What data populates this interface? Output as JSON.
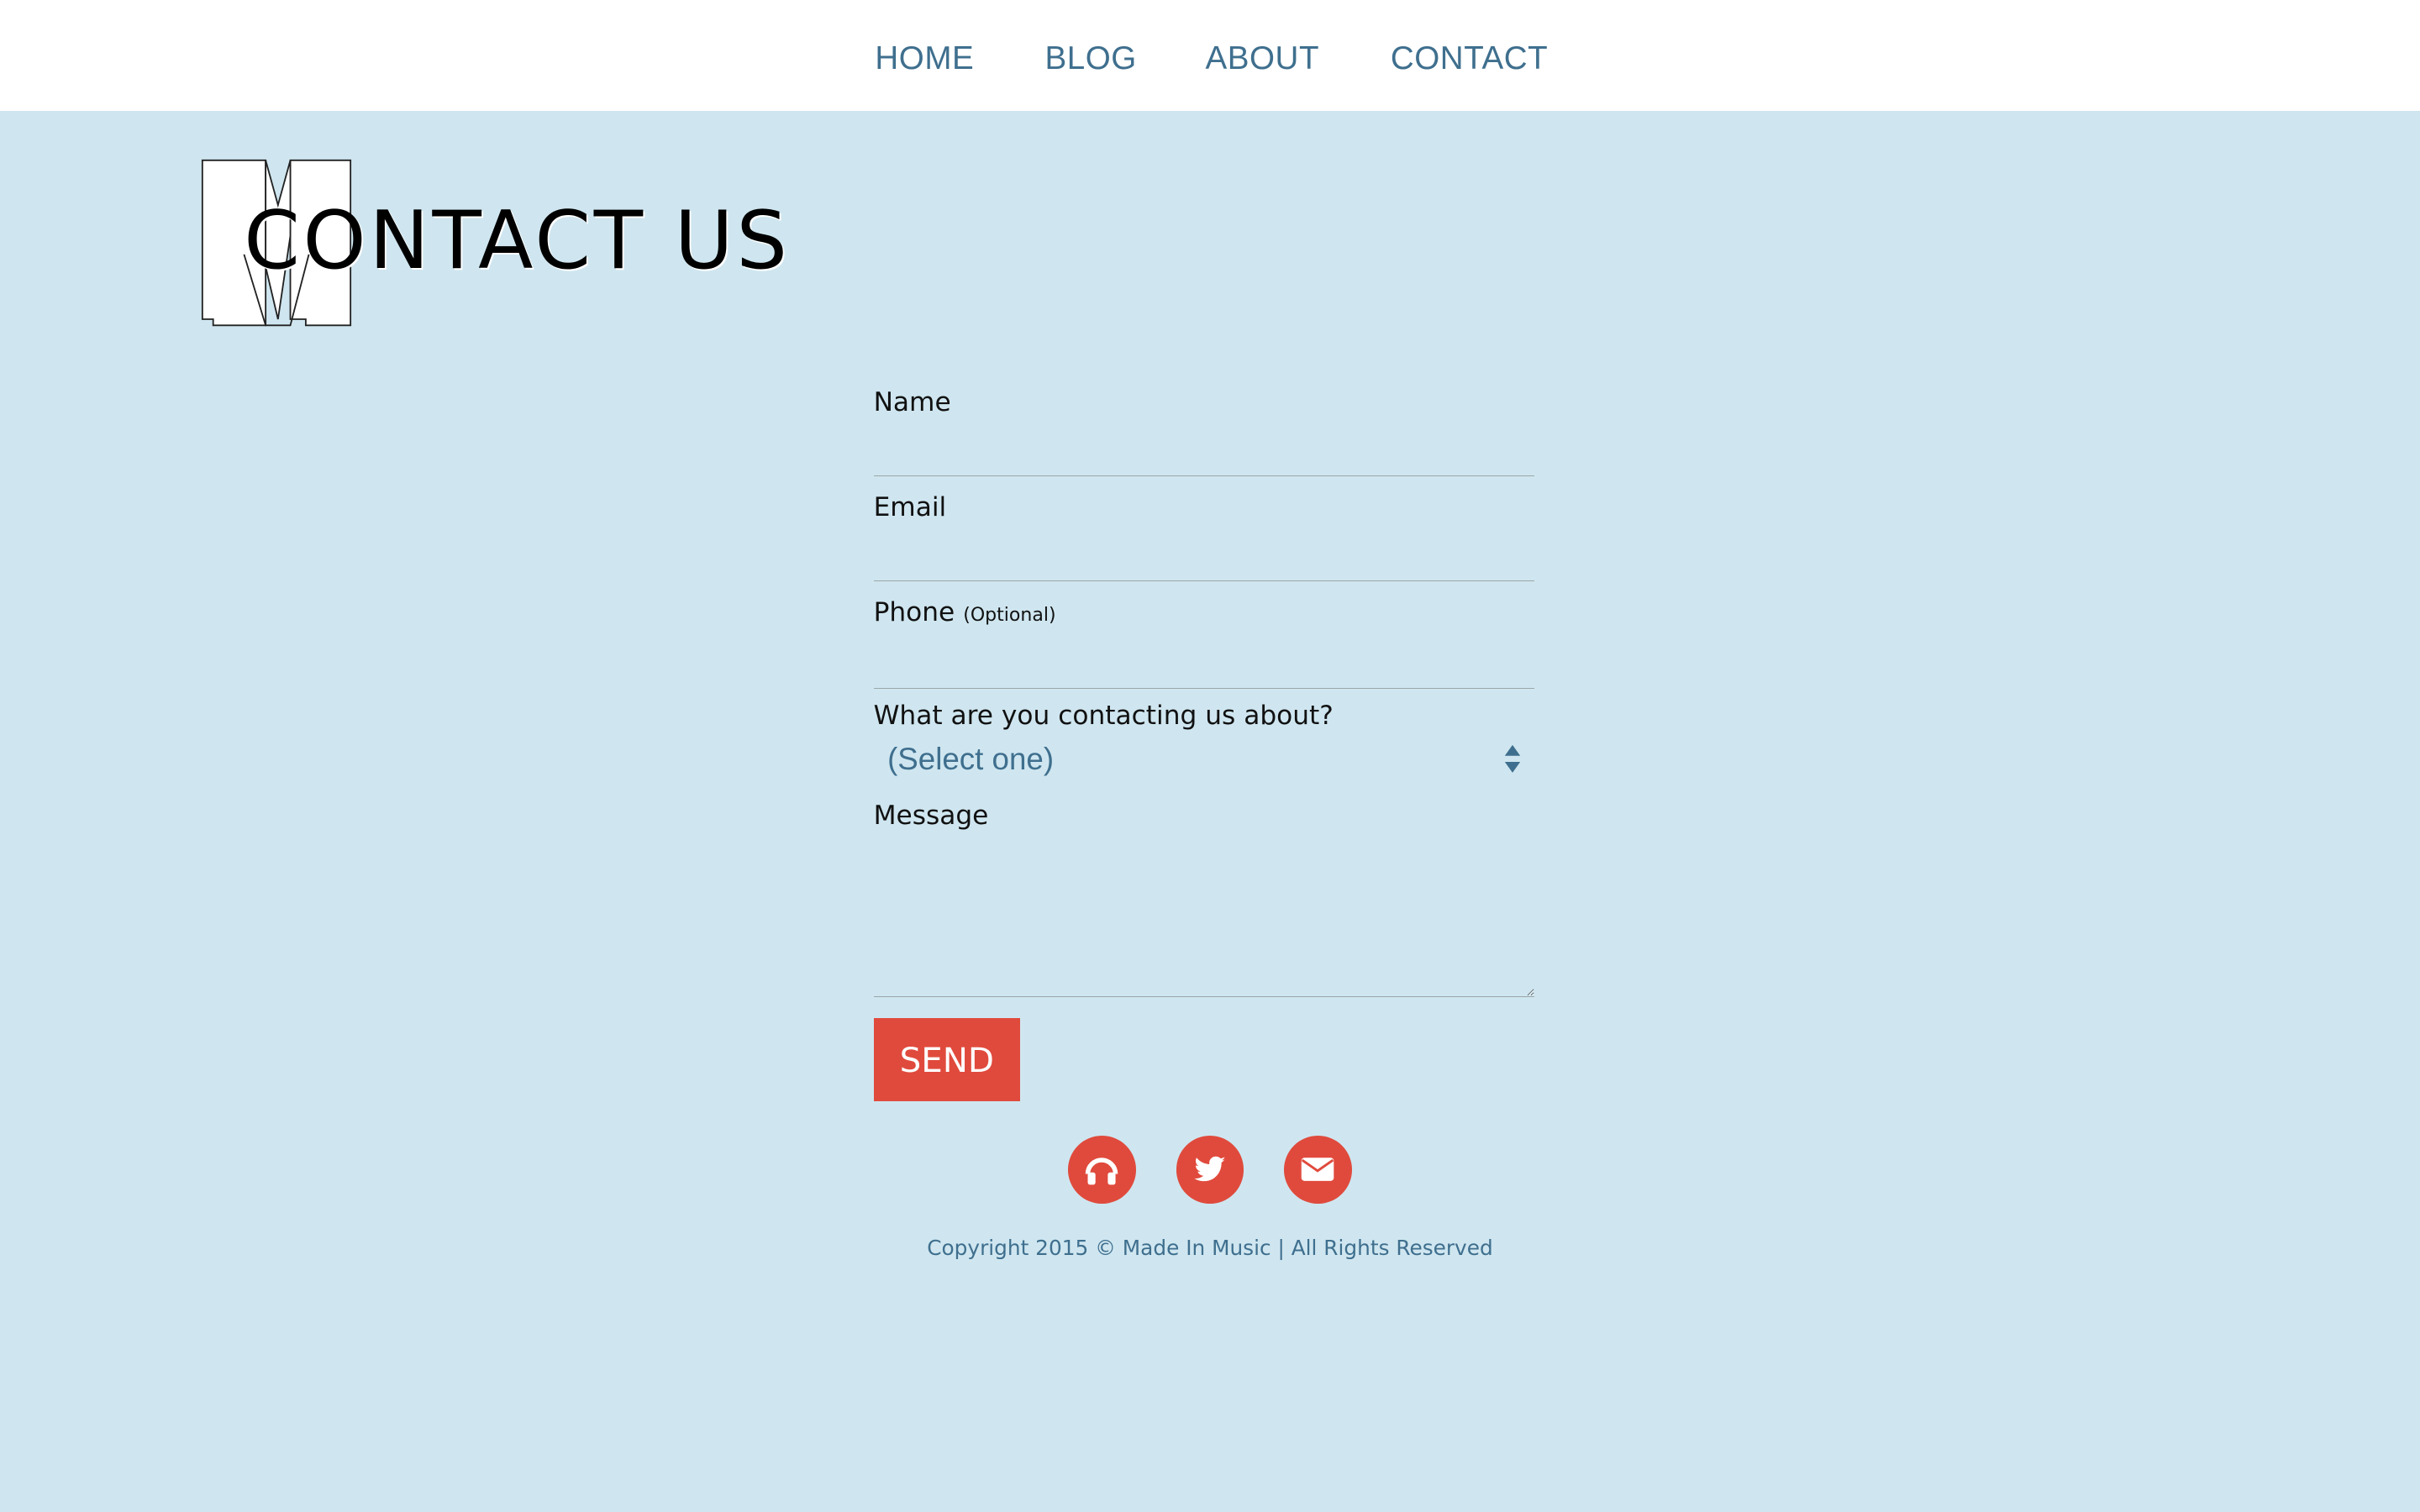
{
  "nav": {
    "items": [
      "HOME",
      "BLOG",
      "ABOUT",
      "CONTACT"
    ]
  },
  "logo": {
    "letter": "M"
  },
  "page": {
    "title": "CONTACT US"
  },
  "form": {
    "name_label": "Name",
    "email_label": "Email",
    "phone_label": "Phone",
    "phone_note": "(Optional)",
    "topic_label": "What are you contacting us about?",
    "topic_selected": "(Select one)",
    "message_label": "Message",
    "send_label": "SEND"
  },
  "social": {
    "icons": [
      "headphones-icon",
      "twitter-icon",
      "email-icon"
    ]
  },
  "footer": {
    "copyright": "Copyright 2015 © Made In Music | All Rights Reserved"
  },
  "colors": {
    "background": "#cfe6f0",
    "nav_text": "#3f6f8e",
    "accent": "#e04a3c",
    "header_bg": "#ffffff"
  }
}
